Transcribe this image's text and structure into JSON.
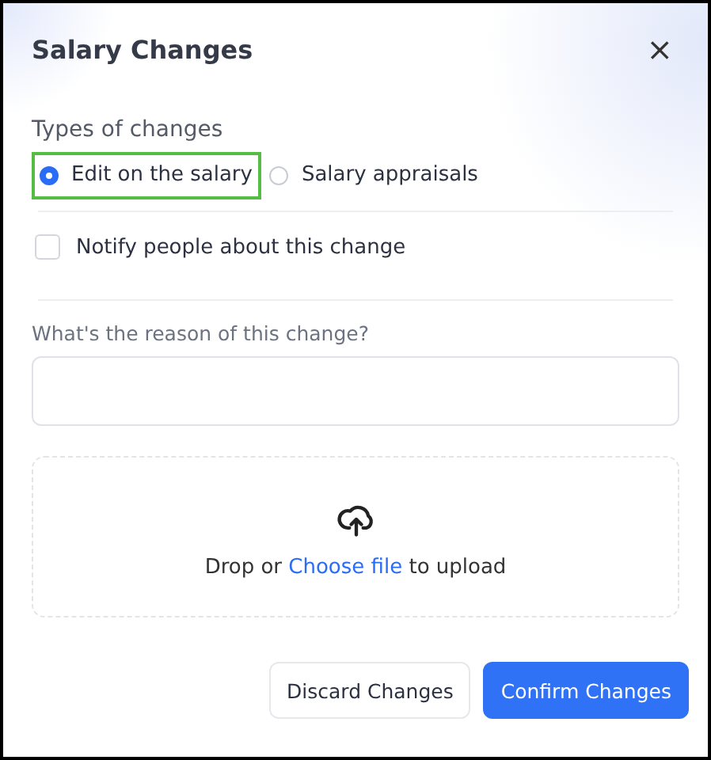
{
  "dialog": {
    "title": "Salary Changes",
    "close": "×"
  },
  "types": {
    "label": "Types of changes",
    "options": [
      {
        "label": "Edit on the salary",
        "selected": true,
        "highlighted": true
      },
      {
        "label": "Salary appraisals",
        "selected": false,
        "highlighted": false
      }
    ]
  },
  "notify": {
    "label": "Notify people about this change",
    "checked": false
  },
  "reason": {
    "label": "What's the reason of this change?"
  },
  "upload": {
    "before": "Drop or",
    "link": "Choose file",
    "after": "to upload"
  },
  "buttons": [
    {
      "label": "Discard Changes",
      "kind": "secondary"
    },
    {
      "label": "Confirm Changes",
      "kind": "primary"
    }
  ]
}
